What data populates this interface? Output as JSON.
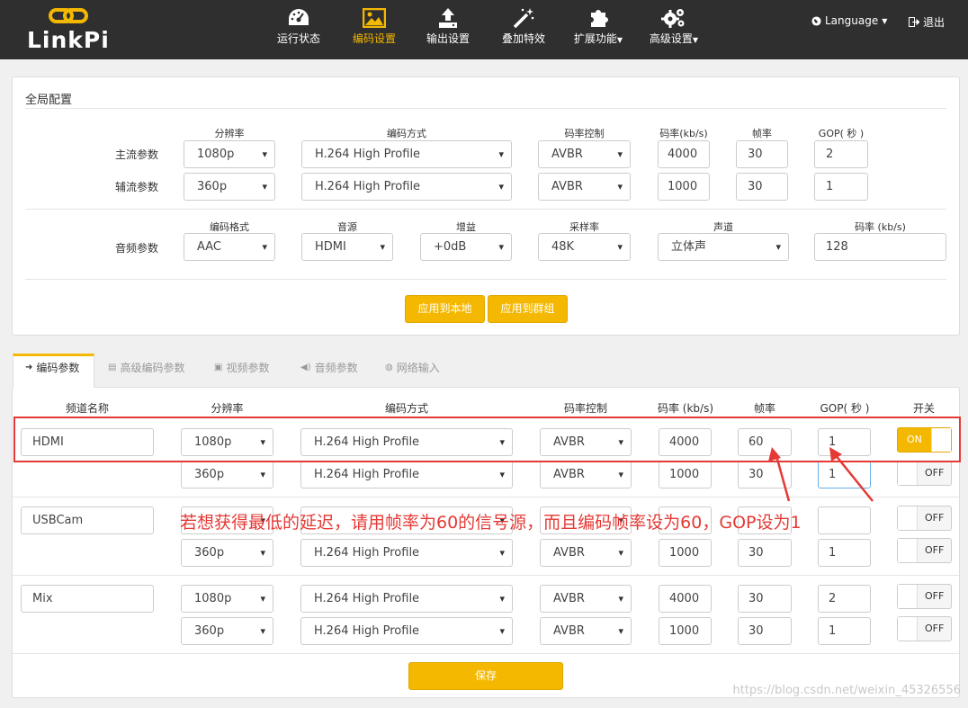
{
  "brand": {
    "name": "LinkPi"
  },
  "nav": {
    "items": [
      {
        "label": "运行状态",
        "icon": "dashboard-icon"
      },
      {
        "label": "编码设置",
        "icon": "image-icon"
      },
      {
        "label": "输出设置",
        "icon": "upload-icon"
      },
      {
        "label": "叠加特效",
        "icon": "magic-wand-icon"
      },
      {
        "label": "扩展功能",
        "icon": "puzzle-icon"
      },
      {
        "label": "高级设置",
        "icon": "gears-icon"
      }
    ],
    "language": "Language",
    "logout": "退出"
  },
  "global": {
    "title": "全局配置",
    "headers": {
      "resolution": "分辨率",
      "codec": "编码方式",
      "rate_control": "码率控制",
      "bitrate": "码率(kb/s)",
      "fps": "帧率",
      "gop": "GOP( 秒 )"
    },
    "main": {
      "label": "主流参数",
      "resolution": "1080p",
      "codec": "H.264 High Profile",
      "rate_control": "AVBR",
      "bitrate": "4000",
      "fps": "30",
      "gop": "2"
    },
    "sub": {
      "label": "辅流参数",
      "resolution": "360p",
      "codec": "H.264 High Profile",
      "rate_control": "AVBR",
      "bitrate": "1000",
      "fps": "30",
      "gop": "1"
    },
    "audio_headers": {
      "format": "编码格式",
      "source": "音源",
      "gain": "增益",
      "samplerate": "采样率",
      "channel": "声道",
      "bitrate": "码率 (kb/s)"
    },
    "audio": {
      "label": "音频参数",
      "format": "AAC",
      "source": "HDMI",
      "gain": "+0dB",
      "samplerate": "48K",
      "channel": "立体声",
      "bitrate": "128"
    },
    "apply_local": "应用到本地",
    "apply_group": "应用到群组"
  },
  "tabs": [
    "编码参数",
    "高级编码参数",
    "视频参数",
    "音频参数",
    "网络输入"
  ],
  "channels_headers": {
    "name": "频道名称",
    "resolution": "分辨率",
    "codec": "编码方式",
    "rate_control": "码率控制",
    "bitrate": "码率 (kb/s)",
    "fps": "帧率",
    "gop": "GOP( 秒 )",
    "switch": "开关"
  },
  "channels": [
    {
      "name": "HDMI",
      "main": {
        "resolution": "1080p",
        "codec": "H.264 High Profile",
        "rate_control": "AVBR",
        "bitrate": "4000",
        "fps": "60",
        "gop": "1",
        "switch": "ON"
      },
      "sub": {
        "resolution": "360p",
        "codec": "H.264 High Profile",
        "rate_control": "AVBR",
        "bitrate": "1000",
        "fps": "30",
        "gop": "1",
        "switch": "OFF"
      }
    },
    {
      "name": "USBCam",
      "main": {
        "switch": "OFF"
      },
      "sub": {
        "resolution": "360p",
        "codec": "H.264 High Profile",
        "rate_control": "AVBR",
        "bitrate": "1000",
        "fps": "30",
        "gop": "1",
        "switch": "OFF"
      }
    },
    {
      "name": "Mix",
      "main": {
        "resolution": "1080p",
        "codec": "H.264 High Profile",
        "rate_control": "AVBR",
        "bitrate": "4000",
        "fps": "30",
        "gop": "2",
        "switch": "OFF"
      },
      "sub": {
        "resolution": "360p",
        "codec": "H.264 High Profile",
        "rate_control": "AVBR",
        "bitrate": "1000",
        "fps": "30",
        "gop": "1",
        "switch": "OFF"
      }
    }
  ],
  "save": "保存",
  "annotation": "若想获得最低的延迟，请用帧率为60的信号源，而且编码帧率设为60，GOP设为1",
  "watermark": "https://blog.csdn.net/weixin_45326556",
  "colors": {
    "accent": "#f5b800",
    "navbar": "#2f2f2f",
    "annotation": "#e53935"
  }
}
